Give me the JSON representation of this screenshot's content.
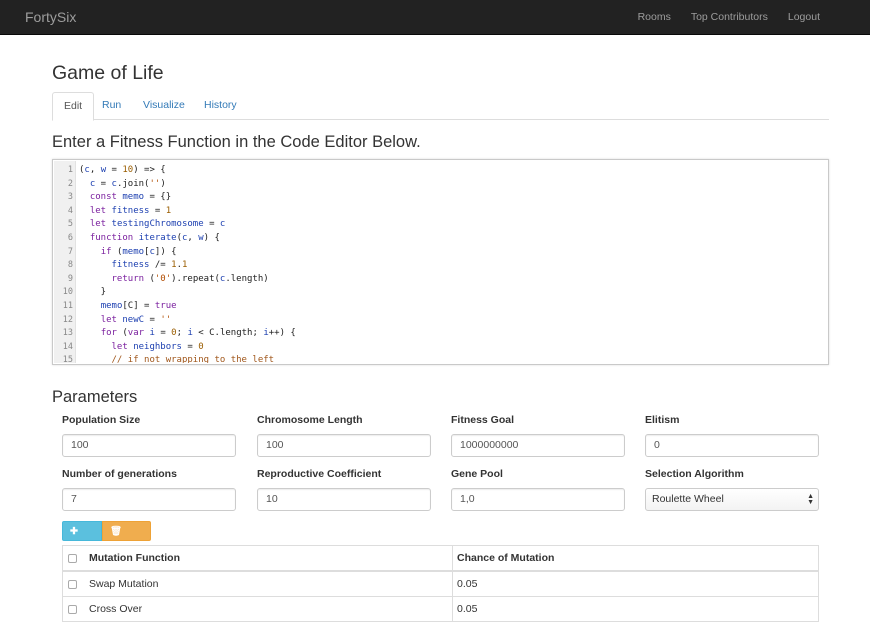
{
  "navbar": {
    "brand": "FortySix",
    "links": [
      "Rooms",
      "Top Contributors",
      "Logout"
    ]
  },
  "page": {
    "title": "Game of Life",
    "tabs": [
      "Edit",
      "Run",
      "Visualize",
      "History"
    ],
    "active_tab": "Edit"
  },
  "editor": {
    "heading": "Enter a Fitness Function in the Code Editor Below.",
    "lines": [
      "(c, w = 10) => {",
      "  c = c.join('')",
      "  const memo = {}",
      "  let fitness = 1",
      "  let testingChromosome = c",
      "  function iterate(c, w) {",
      "    if (memo[c]) {",
      "      fitness /= 1.1",
      "      return ('0').repeat(c.length)",
      "    }",
      "    memo[C] = true",
      "    let newC = ''",
      "    for (var i = 0; i < C.length; i++) {",
      "      let neighbors = 0",
      "      // if not wrapping to the left"
    ]
  },
  "parameters": {
    "heading": "Parameters",
    "fields": [
      {
        "label": "Population Size",
        "value": "100"
      },
      {
        "label": "Chromosome Length",
        "value": "100"
      },
      {
        "label": "Fitness Goal",
        "value": "1000000000"
      },
      {
        "label": "Elitism",
        "value": "0"
      },
      {
        "label": "Number of generations",
        "value": "7"
      },
      {
        "label": "Reproductive Coefficient",
        "value": "10"
      },
      {
        "label": "Gene Pool",
        "value": "1,0"
      }
    ],
    "selection": {
      "label": "Selection Algorithm",
      "value": "Roulette Wheel"
    }
  },
  "buttons": {
    "new": "New",
    "delete": "Delete"
  },
  "mutation_table": {
    "headers": [
      "Mutation Function",
      "Chance of Mutation"
    ],
    "rows": [
      [
        "Swap Mutation",
        "0.05"
      ],
      [
        "Cross Over",
        "0.05"
      ]
    ]
  },
  "colors": {
    "navbar": "#222222",
    "link": "#337ab7",
    "info": "#5bc0de",
    "warning": "#f0ad4e"
  }
}
